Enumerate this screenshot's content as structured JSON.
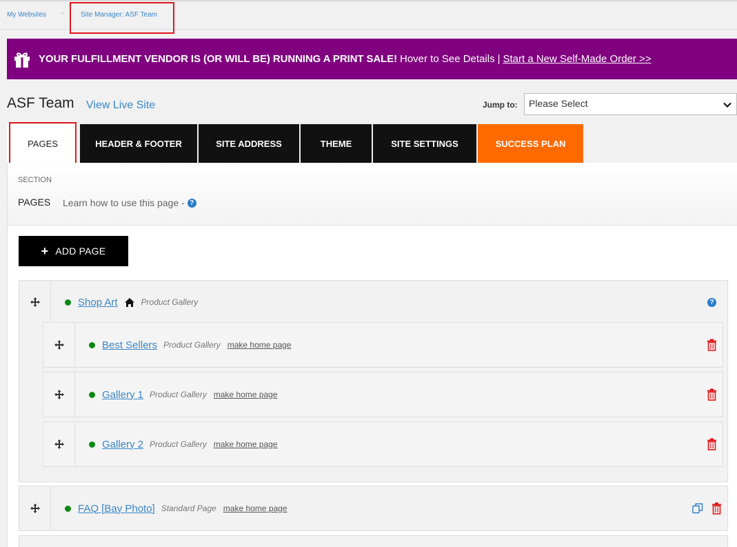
{
  "breadcrumb": {
    "items": [
      "My Websites",
      "Site Manager: ASF Team"
    ],
    "separator": "-"
  },
  "banner": {
    "bold_text": "YOUR FULFILLMENT VENDOR IS (OR WILL BE) RUNNING A PRINT SALE!",
    "hover_text": "Hover to See Details",
    "divider": "|",
    "link_text": "Start a New Self-Made Order >>",
    "color": "#800080"
  },
  "site": {
    "title": "ASF Team",
    "view_live": "View Live Site"
  },
  "jump": {
    "label": "Jump to:",
    "selected": "Please Select"
  },
  "tabs": [
    {
      "label": "PAGES",
      "active": true
    },
    {
      "label": "HEADER & FOOTER"
    },
    {
      "label": "SITE ADDRESS"
    },
    {
      "label": "THEME"
    },
    {
      "label": "SITE SETTINGS"
    },
    {
      "label": "SUCCESS PLAN",
      "color": "#ff6a00"
    }
  ],
  "section": {
    "label": "SECTION",
    "name": "PAGES",
    "help": "Learn how to use this page -"
  },
  "add_page": "ADD PAGE",
  "pages": {
    "root": {
      "name": "Shop Art",
      "type": "Product Gallery",
      "is_home": true
    },
    "children": [
      {
        "name": "Best Sellers",
        "type": "Product Gallery",
        "make_home": "make home page"
      },
      {
        "name": "Gallery 1",
        "type": "Product Gallery",
        "make_home": "make home page"
      },
      {
        "name": "Gallery 2",
        "type": "Product Gallery",
        "make_home": "make home page"
      }
    ],
    "faq": {
      "name": "FAQ [Bay Photo]",
      "type": "Standard Page",
      "make_home": "make home page"
    }
  },
  "colors": {
    "link": "#3a86c8",
    "status_active": "#0b8a13",
    "delete": "#e0161c",
    "highlight_box": "#e0161c"
  }
}
